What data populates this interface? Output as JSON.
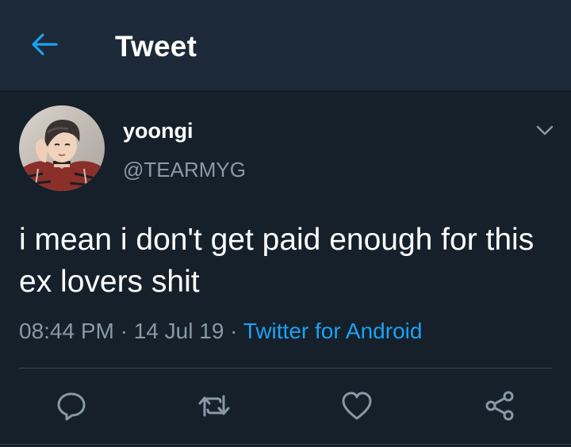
{
  "header": {
    "back_icon": "arrow-left-icon",
    "title": "Tweet"
  },
  "tweet": {
    "author": {
      "display_name": "yoongi",
      "handle": "@TEARMYG"
    },
    "menu_icon": "chevron-down-icon",
    "text": "i mean i don't get paid enough for this ex lovers shit",
    "time": "08:44 PM",
    "date": "14 Jul 19",
    "separator": "·",
    "source": "Twitter for Android",
    "actions": [
      {
        "name": "reply",
        "icon": "reply-bubble-icon"
      },
      {
        "name": "retweet",
        "icon": "retweet-icon"
      },
      {
        "name": "like",
        "icon": "heart-icon"
      },
      {
        "name": "share",
        "icon": "share-icon"
      }
    ]
  },
  "colors": {
    "background": "#15202b",
    "header": "#1c2938",
    "secondary_text": "#8899a6",
    "accent": "#1da1f2",
    "divider": "#38444d"
  }
}
